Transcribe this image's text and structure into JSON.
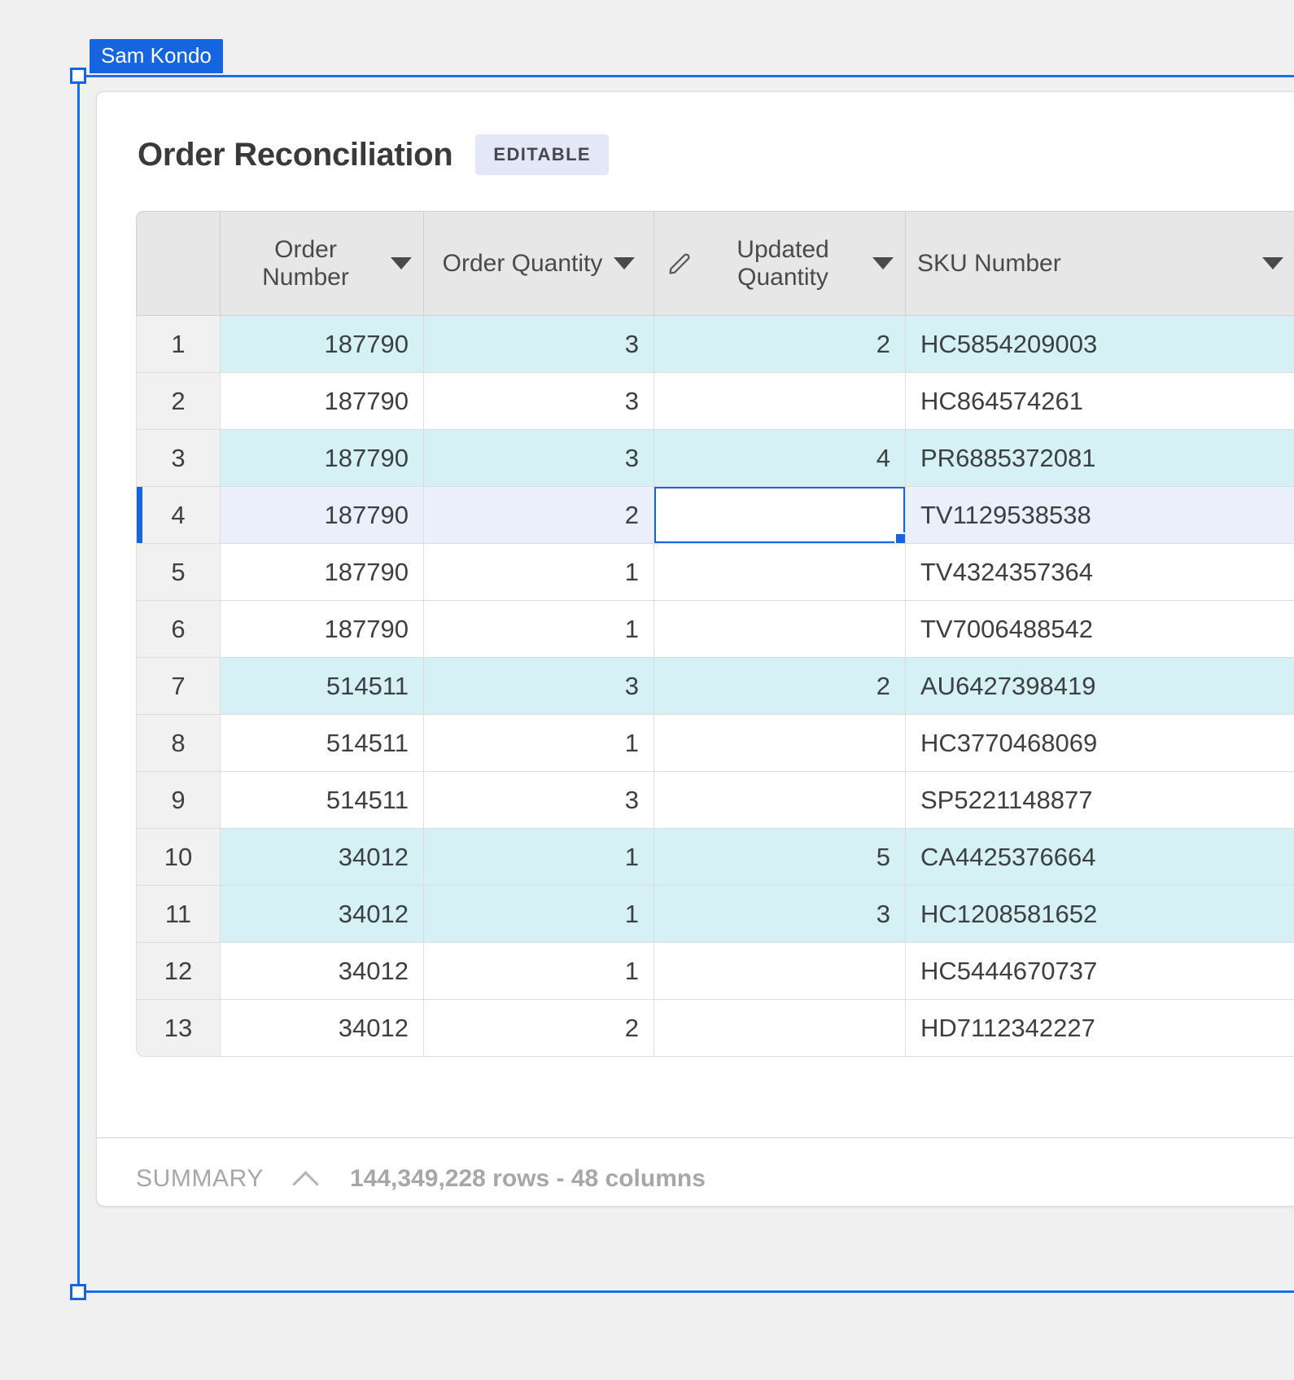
{
  "collaborator": {
    "name": "Sam Kondo"
  },
  "card": {
    "title": "Order Reconciliation",
    "badge": "EDITABLE"
  },
  "table": {
    "columns": [
      {
        "key": "index",
        "label": "",
        "has_caret": false,
        "has_pencil": false,
        "align": "center"
      },
      {
        "key": "order_number",
        "label": "Order Number",
        "has_caret": true,
        "has_pencil": false,
        "align": "right"
      },
      {
        "key": "order_quantity",
        "label": "Order Quantity",
        "has_caret": true,
        "has_pencil": false,
        "align": "right"
      },
      {
        "key": "updated_quantity",
        "label": "Updated Quantity",
        "has_caret": true,
        "has_pencil": true,
        "align": "right"
      },
      {
        "key": "sku_number",
        "label": "SKU Number",
        "has_caret": true,
        "has_pencil": false,
        "align": "left"
      }
    ],
    "rows": [
      {
        "index": "1",
        "order_number": "187790",
        "order_quantity": "3",
        "updated_quantity": "2",
        "sku_number": "HC5854209003",
        "state": "highlight"
      },
      {
        "index": "2",
        "order_number": "187790",
        "order_quantity": "3",
        "updated_quantity": "",
        "sku_number": "HC864574261",
        "state": "normal"
      },
      {
        "index": "3",
        "order_number": "187790",
        "order_quantity": "3",
        "updated_quantity": "4",
        "sku_number": "PR6885372081",
        "state": "highlight"
      },
      {
        "index": "4",
        "order_number": "187790",
        "order_quantity": "2",
        "updated_quantity": "",
        "sku_number": "TV1129538538",
        "state": "selected"
      },
      {
        "index": "5",
        "order_number": "187790",
        "order_quantity": "1",
        "updated_quantity": "",
        "sku_number": "TV4324357364",
        "state": "normal"
      },
      {
        "index": "6",
        "order_number": "187790",
        "order_quantity": "1",
        "updated_quantity": "",
        "sku_number": "TV7006488542",
        "state": "normal"
      },
      {
        "index": "7",
        "order_number": "514511",
        "order_quantity": "3",
        "updated_quantity": "2",
        "sku_number": "AU6427398419",
        "state": "highlight"
      },
      {
        "index": "8",
        "order_number": "514511",
        "order_quantity": "1",
        "updated_quantity": "",
        "sku_number": "HC3770468069",
        "state": "normal"
      },
      {
        "index": "9",
        "order_number": "514511",
        "order_quantity": "3",
        "updated_quantity": "",
        "sku_number": "SP5221148877",
        "state": "normal"
      },
      {
        "index": "10",
        "order_number": "34012",
        "order_quantity": "1",
        "updated_quantity": "5",
        "sku_number": "CA4425376664",
        "state": "highlight"
      },
      {
        "index": "11",
        "order_number": "34012",
        "order_quantity": "1",
        "updated_quantity": "3",
        "sku_number": "HC1208581652",
        "state": "highlight"
      },
      {
        "index": "12",
        "order_number": "34012",
        "order_quantity": "1",
        "updated_quantity": "",
        "sku_number": "HC5444670737",
        "state": "normal"
      },
      {
        "index": "13",
        "order_number": "34012",
        "order_quantity": "2",
        "updated_quantity": "",
        "sku_number": "HD7112342227",
        "state": "normal"
      }
    ],
    "active_cell": {
      "row_index": "4",
      "column": "updated_quantity",
      "value": ""
    }
  },
  "summary": {
    "label": "SUMMARY",
    "toggle_icon": "chevron-up-icon",
    "counts": "144,349,228 rows - 48 columns"
  },
  "colors": {
    "selection_blue": "#1565e0",
    "row_highlight": "#d5f1f5",
    "row_selected": "#eaeffb",
    "badge_bg": "#e3e7f7",
    "header_bg": "#e7e7e7"
  }
}
